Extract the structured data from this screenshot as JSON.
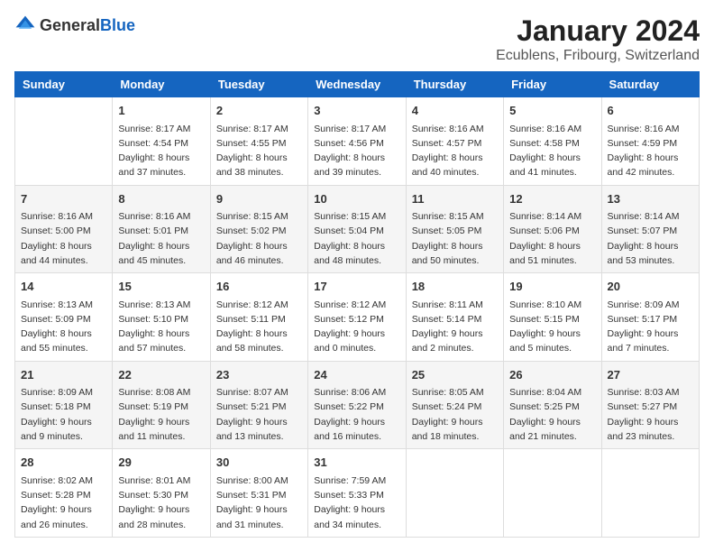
{
  "logo": {
    "text_general": "General",
    "text_blue": "Blue"
  },
  "title": "January 2024",
  "location": "Ecublens, Fribourg, Switzerland",
  "days_of_week": [
    "Sunday",
    "Monday",
    "Tuesday",
    "Wednesday",
    "Thursday",
    "Friday",
    "Saturday"
  ],
  "weeks": [
    [
      {
        "day": "",
        "info": ""
      },
      {
        "day": "1",
        "info": "Sunrise: 8:17 AM\nSunset: 4:54 PM\nDaylight: 8 hours\nand 37 minutes."
      },
      {
        "day": "2",
        "info": "Sunrise: 8:17 AM\nSunset: 4:55 PM\nDaylight: 8 hours\nand 38 minutes."
      },
      {
        "day": "3",
        "info": "Sunrise: 8:17 AM\nSunset: 4:56 PM\nDaylight: 8 hours\nand 39 minutes."
      },
      {
        "day": "4",
        "info": "Sunrise: 8:16 AM\nSunset: 4:57 PM\nDaylight: 8 hours\nand 40 minutes."
      },
      {
        "day": "5",
        "info": "Sunrise: 8:16 AM\nSunset: 4:58 PM\nDaylight: 8 hours\nand 41 minutes."
      },
      {
        "day": "6",
        "info": "Sunrise: 8:16 AM\nSunset: 4:59 PM\nDaylight: 8 hours\nand 42 minutes."
      }
    ],
    [
      {
        "day": "7",
        "info": "Sunrise: 8:16 AM\nSunset: 5:00 PM\nDaylight: 8 hours\nand 44 minutes."
      },
      {
        "day": "8",
        "info": "Sunrise: 8:16 AM\nSunset: 5:01 PM\nDaylight: 8 hours\nand 45 minutes."
      },
      {
        "day": "9",
        "info": "Sunrise: 8:15 AM\nSunset: 5:02 PM\nDaylight: 8 hours\nand 46 minutes."
      },
      {
        "day": "10",
        "info": "Sunrise: 8:15 AM\nSunset: 5:04 PM\nDaylight: 8 hours\nand 48 minutes."
      },
      {
        "day": "11",
        "info": "Sunrise: 8:15 AM\nSunset: 5:05 PM\nDaylight: 8 hours\nand 50 minutes."
      },
      {
        "day": "12",
        "info": "Sunrise: 8:14 AM\nSunset: 5:06 PM\nDaylight: 8 hours\nand 51 minutes."
      },
      {
        "day": "13",
        "info": "Sunrise: 8:14 AM\nSunset: 5:07 PM\nDaylight: 8 hours\nand 53 minutes."
      }
    ],
    [
      {
        "day": "14",
        "info": "Sunrise: 8:13 AM\nSunset: 5:09 PM\nDaylight: 8 hours\nand 55 minutes."
      },
      {
        "day": "15",
        "info": "Sunrise: 8:13 AM\nSunset: 5:10 PM\nDaylight: 8 hours\nand 57 minutes."
      },
      {
        "day": "16",
        "info": "Sunrise: 8:12 AM\nSunset: 5:11 PM\nDaylight: 8 hours\nand 58 minutes."
      },
      {
        "day": "17",
        "info": "Sunrise: 8:12 AM\nSunset: 5:12 PM\nDaylight: 9 hours\nand 0 minutes."
      },
      {
        "day": "18",
        "info": "Sunrise: 8:11 AM\nSunset: 5:14 PM\nDaylight: 9 hours\nand 2 minutes."
      },
      {
        "day": "19",
        "info": "Sunrise: 8:10 AM\nSunset: 5:15 PM\nDaylight: 9 hours\nand 5 minutes."
      },
      {
        "day": "20",
        "info": "Sunrise: 8:09 AM\nSunset: 5:17 PM\nDaylight: 9 hours\nand 7 minutes."
      }
    ],
    [
      {
        "day": "21",
        "info": "Sunrise: 8:09 AM\nSunset: 5:18 PM\nDaylight: 9 hours\nand 9 minutes."
      },
      {
        "day": "22",
        "info": "Sunrise: 8:08 AM\nSunset: 5:19 PM\nDaylight: 9 hours\nand 11 minutes."
      },
      {
        "day": "23",
        "info": "Sunrise: 8:07 AM\nSunset: 5:21 PM\nDaylight: 9 hours\nand 13 minutes."
      },
      {
        "day": "24",
        "info": "Sunrise: 8:06 AM\nSunset: 5:22 PM\nDaylight: 9 hours\nand 16 minutes."
      },
      {
        "day": "25",
        "info": "Sunrise: 8:05 AM\nSunset: 5:24 PM\nDaylight: 9 hours\nand 18 minutes."
      },
      {
        "day": "26",
        "info": "Sunrise: 8:04 AM\nSunset: 5:25 PM\nDaylight: 9 hours\nand 21 minutes."
      },
      {
        "day": "27",
        "info": "Sunrise: 8:03 AM\nSunset: 5:27 PM\nDaylight: 9 hours\nand 23 minutes."
      }
    ],
    [
      {
        "day": "28",
        "info": "Sunrise: 8:02 AM\nSunset: 5:28 PM\nDaylight: 9 hours\nand 26 minutes."
      },
      {
        "day": "29",
        "info": "Sunrise: 8:01 AM\nSunset: 5:30 PM\nDaylight: 9 hours\nand 28 minutes."
      },
      {
        "day": "30",
        "info": "Sunrise: 8:00 AM\nSunset: 5:31 PM\nDaylight: 9 hours\nand 31 minutes."
      },
      {
        "day": "31",
        "info": "Sunrise: 7:59 AM\nSunset: 5:33 PM\nDaylight: 9 hours\nand 34 minutes."
      },
      {
        "day": "",
        "info": ""
      },
      {
        "day": "",
        "info": ""
      },
      {
        "day": "",
        "info": ""
      }
    ]
  ]
}
